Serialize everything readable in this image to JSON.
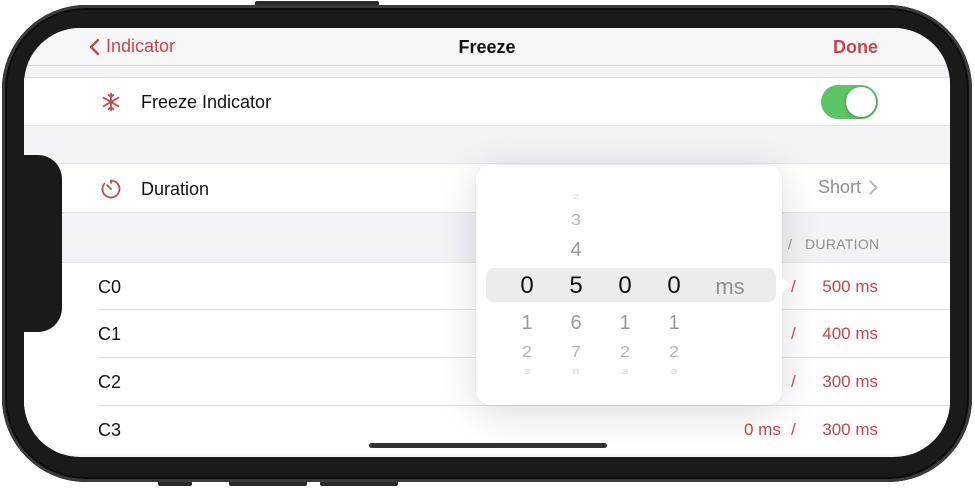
{
  "nav": {
    "back_label": "Indicator",
    "title": "Freeze",
    "done_label": "Done"
  },
  "freeze_indicator": {
    "label": "Freeze Indicator",
    "icon": "snowflake-icon",
    "enabled": true
  },
  "duration": {
    "label": "Duration",
    "icon": "timer-icon",
    "value": "Short"
  },
  "section_header": {
    "slash": "/",
    "column": "DURATION"
  },
  "rows": [
    {
      "name": "C0",
      "min": "",
      "max": "500 ms"
    },
    {
      "name": "C1",
      "min": "",
      "max": "400 ms"
    },
    {
      "name": "C2",
      "min": "",
      "max": "300 ms"
    },
    {
      "name": "C3",
      "min": "0 ms",
      "max": "300 ms"
    }
  ],
  "list_slash": "/",
  "picker": {
    "unit": "ms",
    "wheels": [
      {
        "selected": "0",
        "above": [],
        "below": [
          "1",
          "2",
          "3"
        ]
      },
      {
        "selected": "5",
        "above": [
          "2",
          "3",
          "4"
        ],
        "below": [
          "6",
          "7",
          "8"
        ]
      },
      {
        "selected": "0",
        "above": [],
        "below": [
          "1",
          "2",
          "3"
        ]
      },
      {
        "selected": "0",
        "above": [],
        "below": [
          "1",
          "2",
          "3"
        ]
      }
    ]
  },
  "colors": {
    "accent": "#c8474c",
    "toggle_on": "#5cc466",
    "secondary_text": "#8e8e93"
  }
}
